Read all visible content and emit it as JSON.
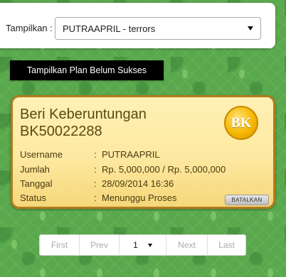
{
  "filter": {
    "label": "Tampilkan :",
    "selected": "PUTRAAPRIL - terrors"
  },
  "plan_button_label": "Tampilkan Plan Belum Sukses",
  "card": {
    "title": "Beri Keberuntungan",
    "code": "BK50022288",
    "badge": "BK",
    "rows": [
      {
        "label": "Username",
        "sep": ":",
        "value": "PUTRAAPRIL"
      },
      {
        "label": "Jumlah",
        "sep": ":",
        "value": "Rp. 5,000,000 / Rp. 5,000,000"
      },
      {
        "label": "Tanggal",
        "sep": ":",
        "value": "28/09/2014 16:36"
      },
      {
        "label": "Status",
        "sep": ":",
        "value": "Menunggu Proses"
      }
    ],
    "cancel_label": "BATALKAN"
  },
  "pagination": {
    "first": "First",
    "prev": "Prev",
    "page": "1",
    "next": "Next",
    "last": "Last"
  },
  "colors": {
    "background_green": "#5aa84d",
    "card_border": "#b07d1e",
    "card_fill": "#fde9a1",
    "badge_gold": "#f5b800"
  }
}
